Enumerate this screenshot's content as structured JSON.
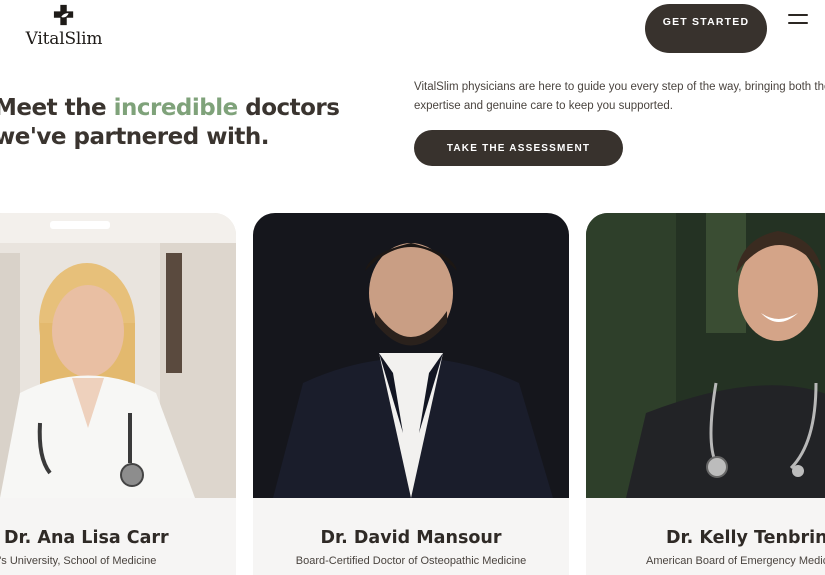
{
  "brand": {
    "name": "VitalSlim",
    "logo_icon": "medical-cross-icon"
  },
  "header": {
    "cta_label": "GET STARTED",
    "menu_icon": "hamburger-menu-icon"
  },
  "hero": {
    "headline_prefix": "Meet the ",
    "headline_accent": "incredible",
    "headline_suffix": " doctors",
    "headline_line2": "we've partnered with.",
    "intro_line1": "VitalSlim physicians are here to guide you every step of the way, bringing both their",
    "intro_line2": "expertise and genuine care to keep you supported.",
    "cta_label": "TAKE THE ASSESSMENT"
  },
  "colors": {
    "accent": "#7fa27a",
    "button": "#38322d",
    "card_bg": "#f6f5f4"
  },
  "doctors": [
    {
      "name": "Dr. Ana Lisa Carr",
      "credential": "St. George's University, School of Medicine"
    },
    {
      "name": "Dr. David Mansour",
      "credential": "Board-Certified Doctor of Osteopathic Medicine"
    },
    {
      "name": "Dr. Kelly Tenbrink",
      "credential": "American Board of Emergency Medicine"
    }
  ]
}
